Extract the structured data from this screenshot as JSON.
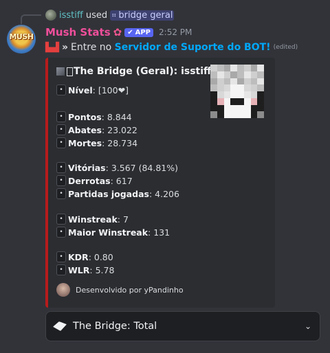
{
  "reply": {
    "username": "isstiff",
    "used_text": "used",
    "command_icon": "slash-command-icon",
    "command": "bridge geral"
  },
  "message": {
    "author": "Mush Stats",
    "app_badge": "APP",
    "timestamp": "2:52 PM",
    "prefix": "»",
    "text": "Entre no",
    "link_text": "Servidor de Suporte do BOT!",
    "edited": "(edited)"
  },
  "embed": {
    "accent_color": "#b71c1c",
    "title": "The Bridge (Geral): isstiff",
    "stats": [
      {
        "label": "Nível",
        "value": ": [100❤]"
      },
      {
        "label": "Pontos",
        "value": ": 8.844"
      },
      {
        "label": "Abates",
        "value": ": 23.022"
      },
      {
        "label": "Mortes",
        "value": ": 28.734"
      },
      {
        "label": "Vitórias",
        "value": ": 3.567 (84.81%)"
      },
      {
        "label": "Derrotas",
        "value": ": 617"
      },
      {
        "label": "Partidas jogadas",
        "value": ": 4.206"
      },
      {
        "label": "Winstreak",
        "value": ": 7"
      },
      {
        "label": "Maior Winstreak",
        "value": ": 131"
      },
      {
        "label": "KDR",
        "value": ": 0.80"
      },
      {
        "label": "WLR",
        "value": ": 5.78"
      }
    ],
    "footer": "Desenvolvido por yPandinho"
  },
  "dropdown": {
    "selected": "The Bridge: Total",
    "icon": "bridge-item-icon"
  },
  "colors": {
    "background": "#323339",
    "username": "#f04f9b",
    "link": "#00a8fc",
    "app_badge": "#5865f2"
  }
}
